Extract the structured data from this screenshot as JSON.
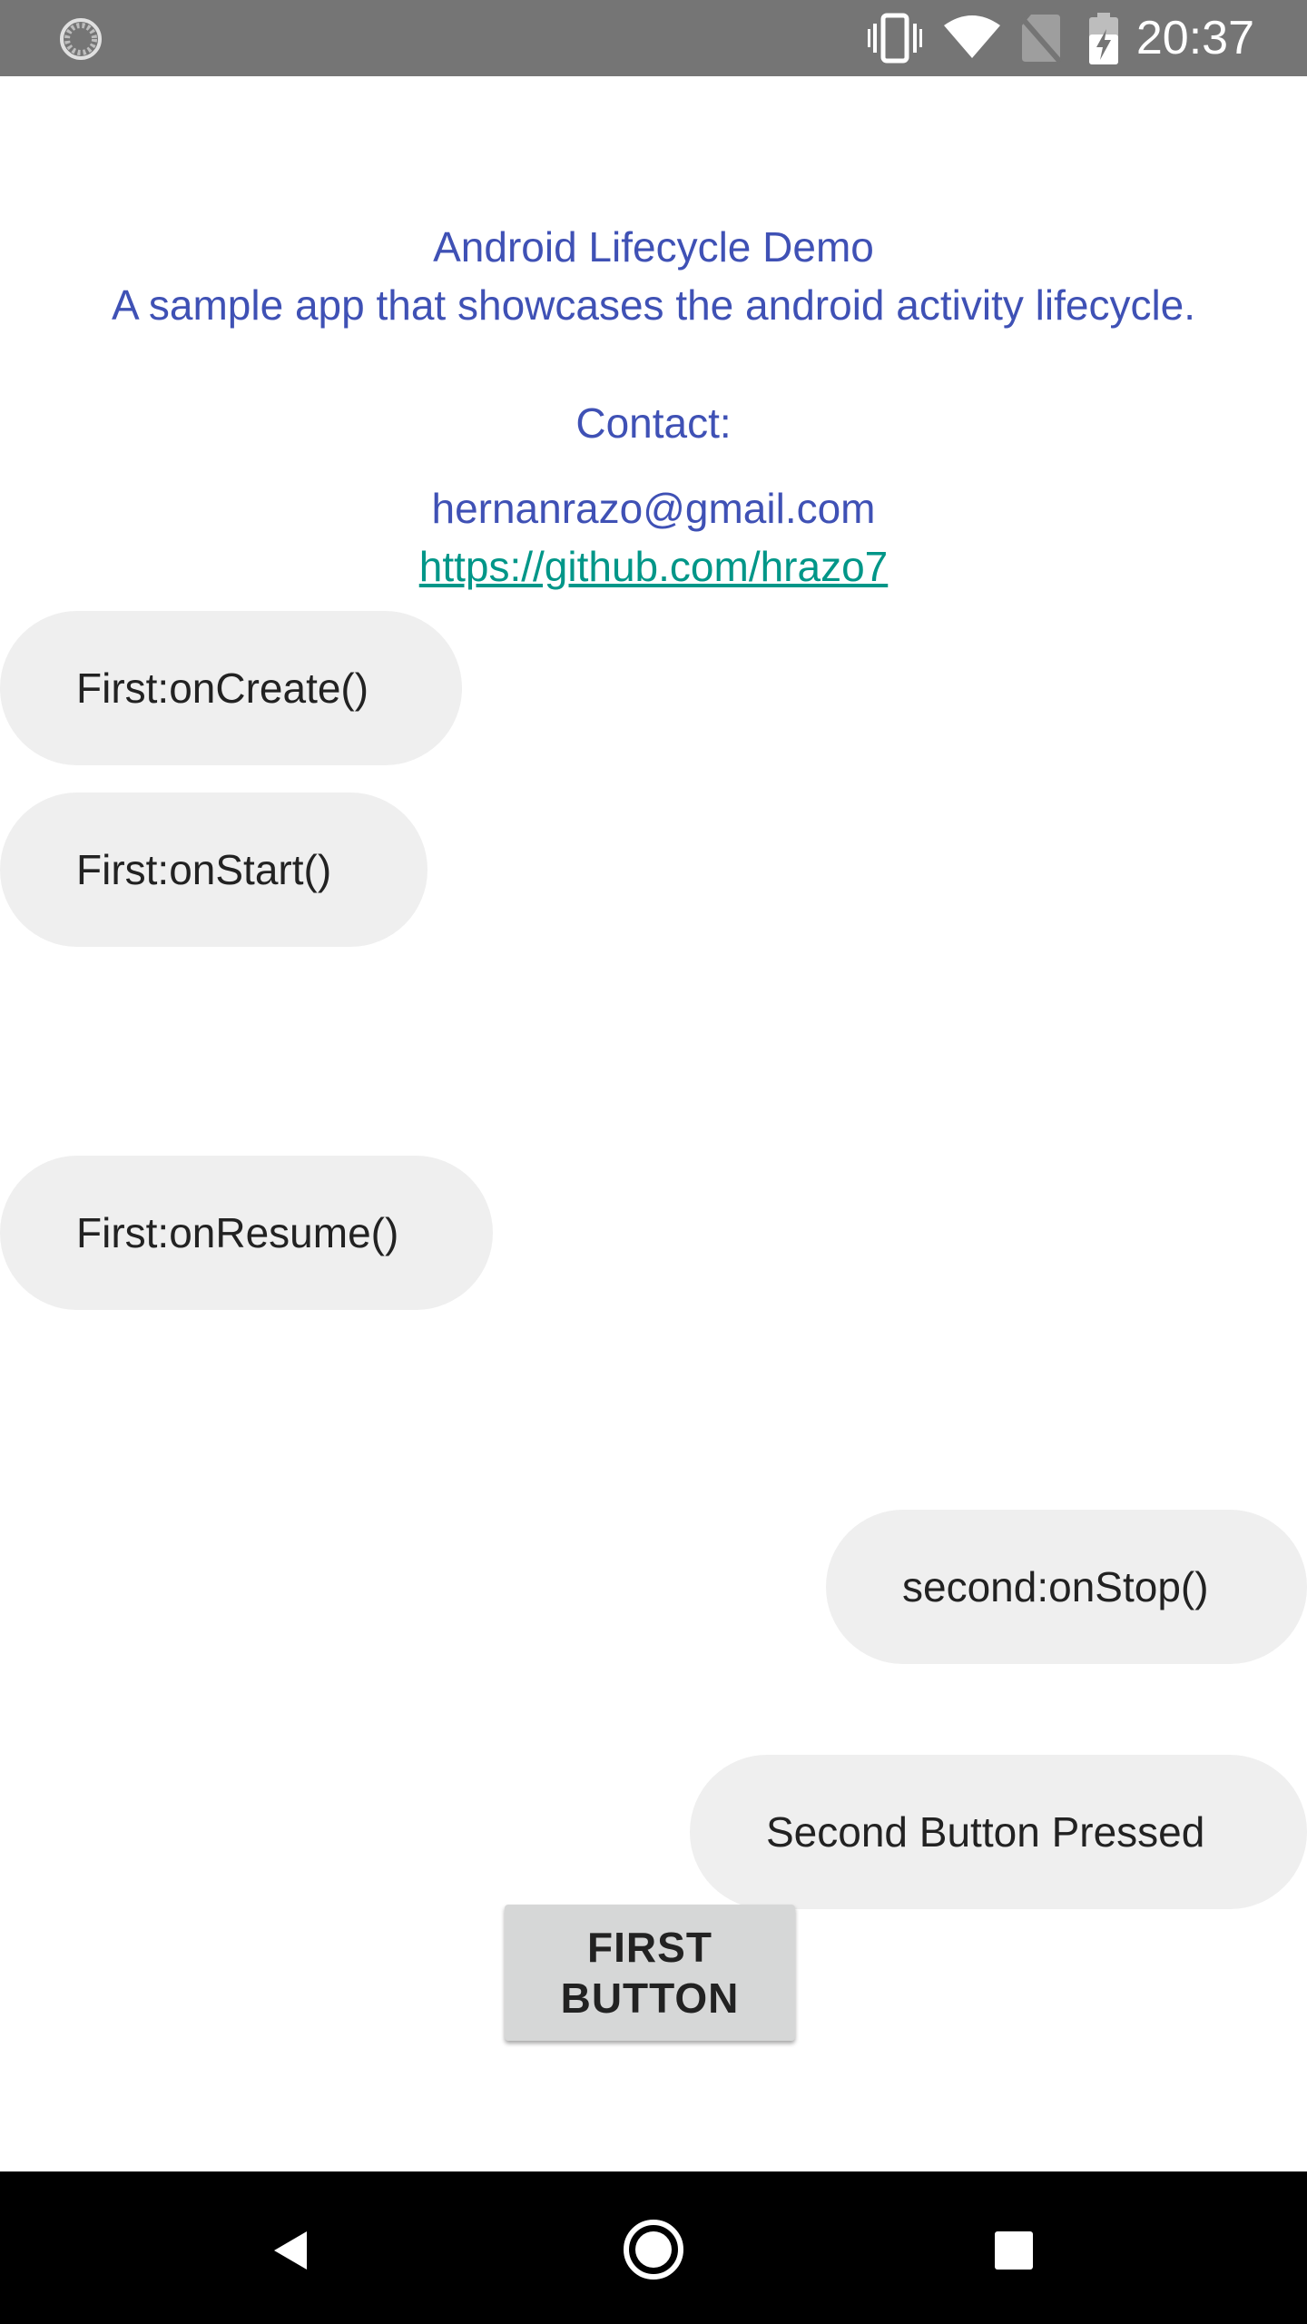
{
  "status_bar": {
    "time": "20:37",
    "icons": [
      "loading-icon",
      "vibrate-icon",
      "wifi-icon",
      "no-sim-icon",
      "battery-charging-icon"
    ]
  },
  "header": {
    "title": "Android Lifecycle Demo",
    "subtitle": "A sample app that showcases the android activity lifecycle.",
    "contact_label": "Contact:",
    "email": "hernanrazo@gmail.com",
    "github_link": "https://github.com/hrazo7"
  },
  "toasts": [
    "First:onCreate()",
    "First:onStart()",
    "First:onResume()",
    "second:onStop()",
    "Second Button Pressed"
  ],
  "first_button": {
    "label": "FIRST BUTTON"
  },
  "nav_bar": {
    "icons": [
      "back-icon",
      "home-icon",
      "recents-icon"
    ]
  },
  "colors": {
    "header_text": "#3f51b5",
    "link": "#009688",
    "status_bar": "#757575",
    "toast_bg": "#efefef",
    "button_bg": "#d6d7d7"
  }
}
